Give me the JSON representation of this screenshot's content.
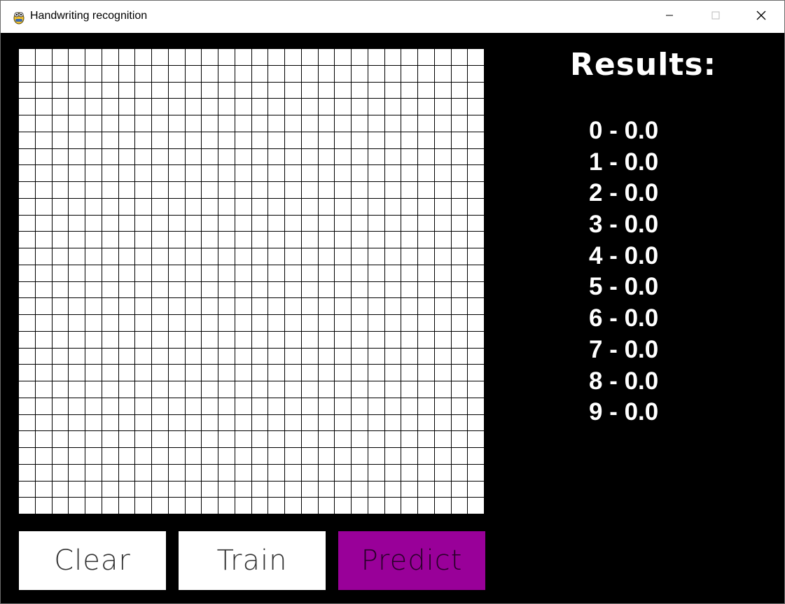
{
  "window": {
    "title": "Handwriting recognition",
    "icon": "pygame-snake-icon",
    "controls": [
      "minimize-icon",
      "maximize-icon",
      "close-icon"
    ]
  },
  "grid": {
    "rows": 28,
    "columns": 28,
    "cell_color": "#ffffff",
    "line_color": "#000000"
  },
  "buttons": {
    "clear": "Clear",
    "train": "Train",
    "predict": "Predict",
    "predict_color": "#990099"
  },
  "results": {
    "title": "Results:",
    "items": [
      "0 - 0.0",
      "1 - 0.0",
      "2 - 0.0",
      "3 - 0.0",
      "4 - 0.0",
      "5 - 0.0",
      "6 - 0.0",
      "7 - 0.0",
      "8 - 0.0",
      "9 - 0.0"
    ]
  }
}
